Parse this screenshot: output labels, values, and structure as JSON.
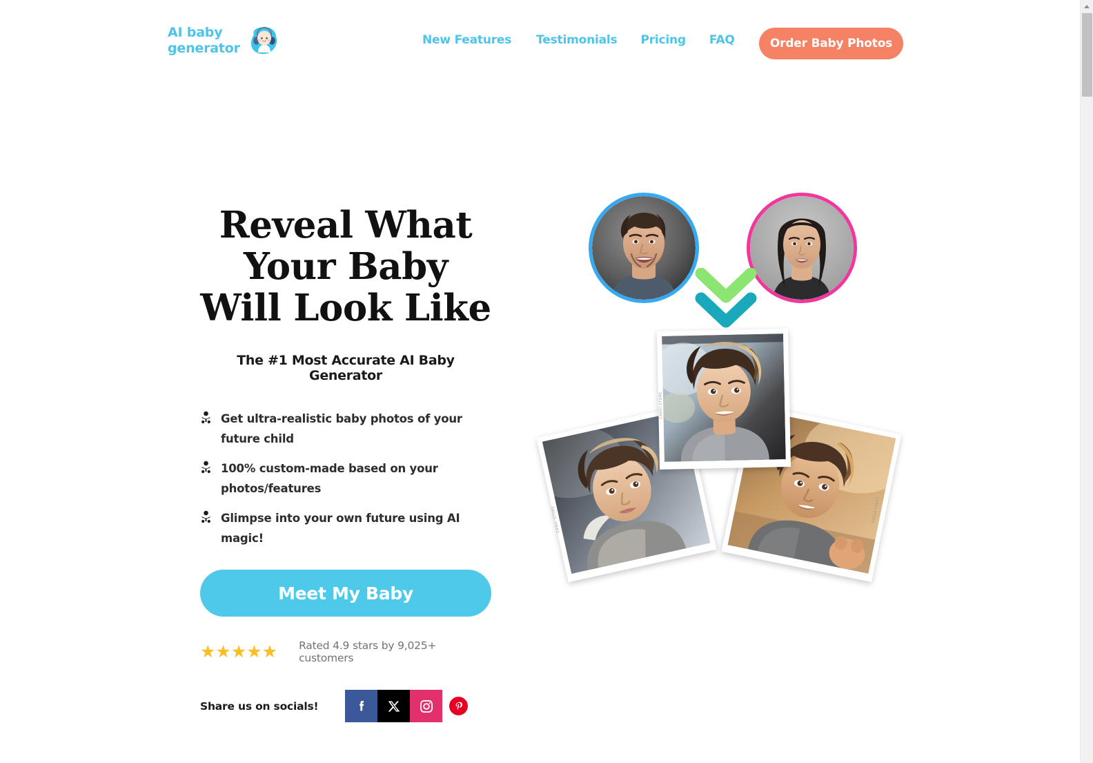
{
  "header": {
    "logo": {
      "line1": "AI baby",
      "line2": "generator",
      "icon": "baby-headphones-logo",
      "color": "#4ec4e8"
    },
    "nav": [
      {
        "label": "New Features"
      },
      {
        "label": "Testimonials"
      },
      {
        "label": "Pricing"
      },
      {
        "label": "FAQ"
      }
    ],
    "cta": {
      "label": "Order Baby Photos",
      "color": "#f58265"
    }
  },
  "hero": {
    "title": "Reveal What Your Baby Will Look Like",
    "subtitle": "The #1 Most Accurate AI Baby Generator",
    "benefits": [
      {
        "icon": "baby-icon",
        "text": "Get ultra-realistic baby photos of your future child"
      },
      {
        "icon": "baby-icon",
        "text": "100% custom-made based on your photos/features"
      },
      {
        "icon": "baby-icon",
        "text": "Glimpse into your own future using AI magic!"
      }
    ],
    "cta": {
      "label": "Meet My Baby",
      "color": "#4ec9ea"
    },
    "rating": {
      "stars": "★★★★★",
      "star_count": 5,
      "star_color": "#fbbf24",
      "text": "Rated 4.9 stars by 9,025+ customers",
      "value": "4.9",
      "customers": "9,025+"
    },
    "socials": {
      "label": "Share us on socials!",
      "items": [
        {
          "name": "facebook",
          "glyph": "f",
          "color": "#3b5998"
        },
        {
          "name": "x-twitter",
          "glyph": "𝕏",
          "color": "#000000"
        },
        {
          "name": "instagram",
          "glyph": "",
          "color": "#e1306c"
        },
        {
          "name": "pinterest",
          "glyph": "P",
          "color": "#e60023"
        }
      ]
    }
  },
  "visual": {
    "parents": [
      {
        "name": "father-photo",
        "ring_color": "#35aaf0"
      },
      {
        "name": "mother-photo",
        "ring_color": "#f0379e"
      }
    ],
    "arrow": {
      "name": "double-chevron-down",
      "top_color": "#8ce472",
      "bottom_color": "#1aa8bb"
    },
    "polaroids": [
      {
        "name": "baby-result-left",
        "film_label": "CANVI STORE"
      },
      {
        "name": "baby-result-center",
        "film_label": "CANVI STORE"
      },
      {
        "name": "baby-result-right",
        "film_label": "CANVI STORE"
      }
    ]
  },
  "browser": {
    "scrollbar": {
      "name": "vertical-scrollbar",
      "thumb_position_percent": 2
    }
  }
}
